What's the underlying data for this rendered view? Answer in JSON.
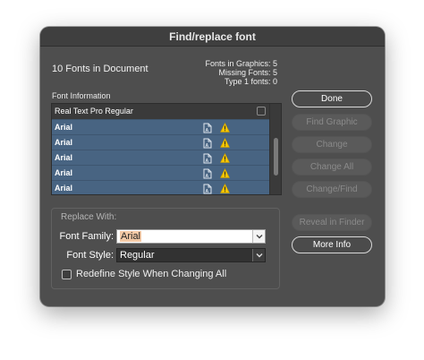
{
  "dialog": {
    "title": "Find/replace font",
    "count_label": "10 Fonts in Document",
    "stats": {
      "graphics": "Fonts in Graphics: 5",
      "missing": "Missing Fonts: 5",
      "type1": "Type 1 fonts: 0"
    }
  },
  "list": {
    "header": "Font Information",
    "rows": [
      {
        "name": "Real Text Pro Regular",
        "selected": false
      },
      {
        "name": "Arial",
        "selected": true
      },
      {
        "name": "Arial",
        "selected": true
      },
      {
        "name": "Arial",
        "selected": true
      },
      {
        "name": "Arial",
        "selected": true
      },
      {
        "name": "Arial",
        "selected": true
      }
    ]
  },
  "buttons": {
    "done": "Done",
    "find_graphic": "Find Graphic",
    "change": "Change",
    "change_all": "Change All",
    "change_find": "Change/Find",
    "reveal": "Reveal in Finder",
    "more_info": "More Info"
  },
  "replace": {
    "group_title": "Replace With:",
    "family_label": "Font Family:",
    "family_value": "Arial",
    "style_label": "Font Style:",
    "style_value": "Regular",
    "redefine_label": "Redefine Style When Changing All",
    "redefine_checked": false
  },
  "colors": {
    "dialog_bg": "#4e4e4e",
    "selection": "#486482",
    "warning": "#f5c400"
  }
}
